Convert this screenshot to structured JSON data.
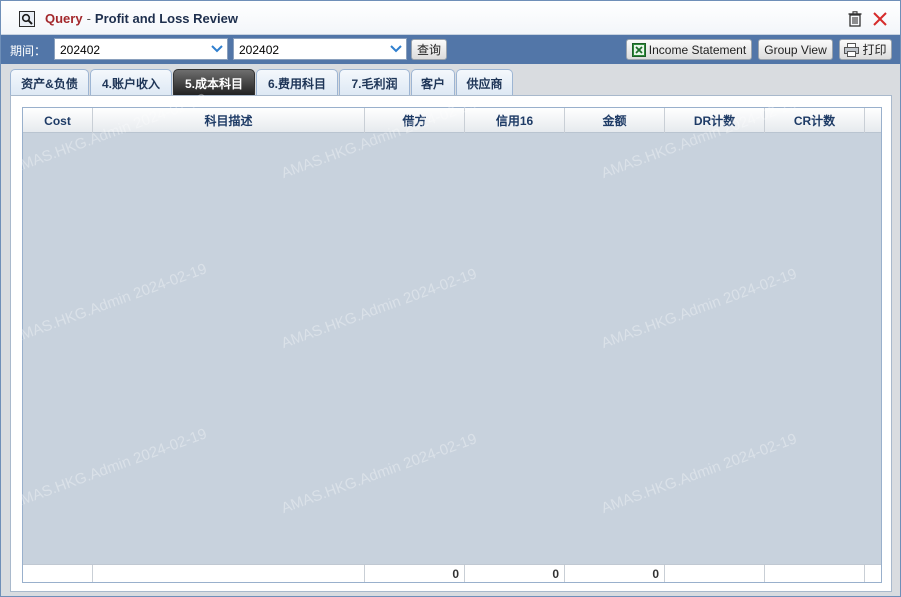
{
  "window": {
    "title_query": "Query",
    "title_sep": "-",
    "title_main": "Profit and Loss Review"
  },
  "toolbar": {
    "period_label": "期间：",
    "period_from": "202402",
    "period_to": "202402",
    "query_button": "查询",
    "income_statement_button": "Income Statement",
    "group_view_button": "Group View",
    "print_button": "打印"
  },
  "tabs": [
    {
      "label": "资产&负债",
      "active": false
    },
    {
      "label": "4.账户收入",
      "active": false
    },
    {
      "label": "5.成本科目",
      "active": true
    },
    {
      "label": "6.费用科目",
      "active": false
    },
    {
      "label": "7.毛利润",
      "active": false
    },
    {
      "label": "客户",
      "active": false
    },
    {
      "label": "供应商",
      "active": false
    }
  ],
  "grid": {
    "columns": [
      "Cost",
      "科目描述",
      "借方",
      "信用16",
      "金额",
      "DR计数",
      "CR计数"
    ],
    "totals": [
      "",
      "",
      "0",
      "0",
      "0",
      "",
      ""
    ]
  },
  "watermark": "AMAS.HKG.Admin 2024-02-19",
  "colors": {
    "toolbar_bg": "#5276a8",
    "title_query": "#a3282c",
    "header_text": "#1e3b66",
    "active_tab": "#2a2a2a",
    "grid_bg": "#c8d2dd"
  },
  "icons": {
    "title": "search-icon",
    "trash": "trash-icon",
    "close": "close-icon",
    "dropdown": "chevron-down-icon",
    "excel": "excel-icon",
    "print": "printer-icon"
  }
}
